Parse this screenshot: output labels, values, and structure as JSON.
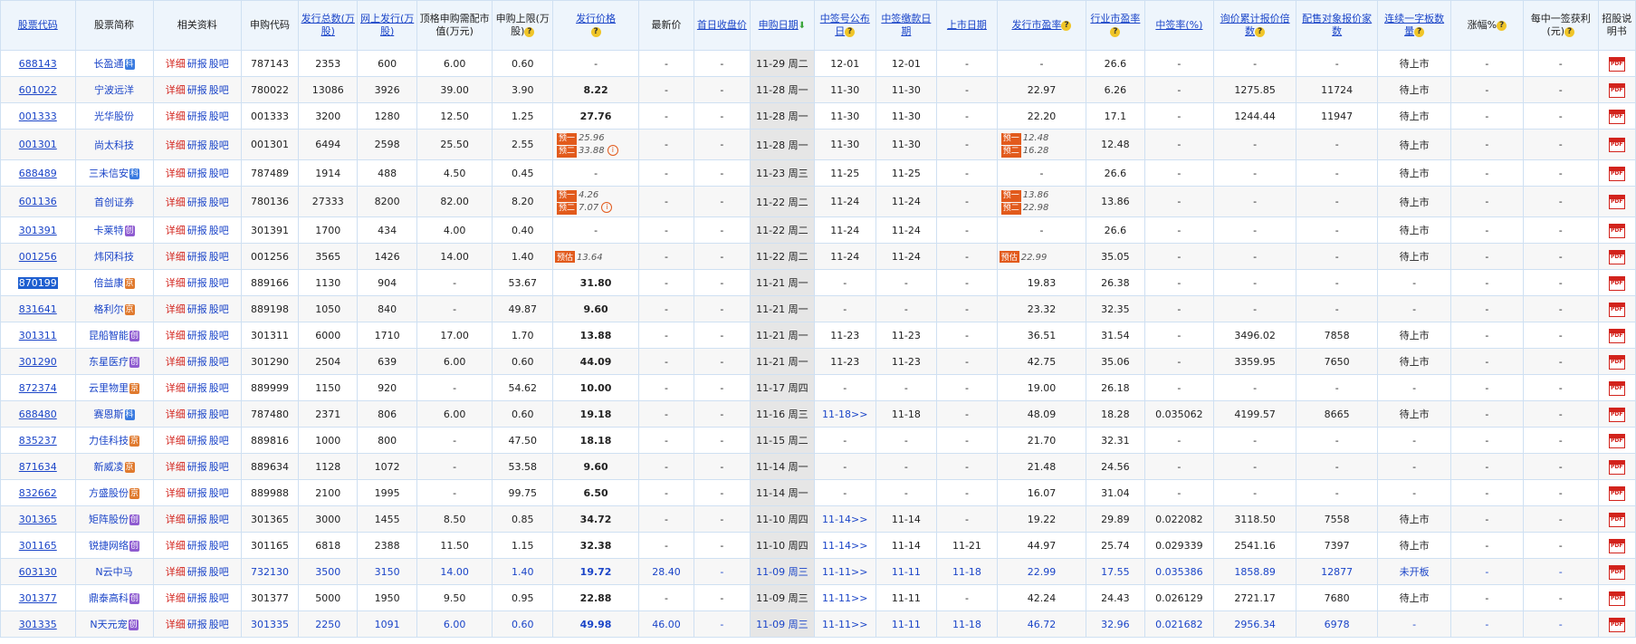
{
  "headers": {
    "code": "股票代码",
    "name": "股票简称",
    "related": "相关资料",
    "sub_code": "申购代码",
    "issue_total": "发行总数(万股)",
    "online_issue": "网上发行(万股)",
    "top_market_value": "顶格申购需配市值(万元)",
    "sub_limit": "申购上限(万股)",
    "issue_price": "发行价格",
    "latest_price": "最新价",
    "first_close": "首日收盘价",
    "sub_date": "申购日期",
    "announce_date": "中签号公布日",
    "pay_date": "中签缴款日期",
    "list_date": "上市日期",
    "issue_pe": "发行市盈率",
    "industry_pe": "行业市盈率",
    "win_rate": "中签率(%)",
    "inquiry_multiple": "询价累计报价倍数",
    "placement_count": "配售对象报价家数",
    "consecutive": "连续一字板数量",
    "change_pct": "涨幅%",
    "profit_per_lot": "每中一签获利(元)",
    "prospectus": "招股说明书"
  },
  "link_labels": {
    "detail": "详细",
    "research": "研报",
    "forum": "股吧"
  },
  "tags": {
    "ke": "科",
    "chuang": "创",
    "jing": "京"
  },
  "pred_labels": {
    "p1": "预一",
    "p2": "预二",
    "est": "预估"
  },
  "rows": [
    {
      "code": "688143",
      "name": "长盈通",
      "tag": "ke",
      "sub_code": "787143",
      "total": "2353",
      "online": "600",
      "topmv": "6.00",
      "limit": "0.60",
      "price": "-",
      "latest": "-",
      "first": "-",
      "date": "11-29 周二",
      "announce": "12-01",
      "pay": "12-01",
      "list": "-",
      "pe": "-",
      "ipe": "26.6",
      "rate": "-",
      "mult": "-",
      "place": "-",
      "cons": "待上市",
      "chg": "-",
      "profit": "-"
    },
    {
      "code": "601022",
      "name": "宁波远洋",
      "tag": "",
      "sub_code": "780022",
      "total": "13086",
      "online": "3926",
      "topmv": "39.00",
      "limit": "3.90",
      "price": "8.22",
      "latest": "-",
      "first": "-",
      "date": "11-28 周一",
      "announce": "11-30",
      "pay": "11-30",
      "list": "-",
      "pe": "22.97",
      "ipe": "6.26",
      "rate": "-",
      "mult": "1275.85",
      "place": "11724",
      "cons": "待上市",
      "chg": "-",
      "profit": "-"
    },
    {
      "code": "001333",
      "name": "光华股份",
      "tag": "",
      "sub_code": "001333",
      "total": "3200",
      "online": "1280",
      "topmv": "12.50",
      "limit": "1.25",
      "price": "27.76",
      "latest": "-",
      "first": "-",
      "date": "11-28 周一",
      "announce": "11-30",
      "pay": "11-30",
      "list": "-",
      "pe": "22.20",
      "ipe": "17.1",
      "rate": "-",
      "mult": "1244.44",
      "place": "11947",
      "cons": "待上市",
      "chg": "-",
      "profit": "-"
    },
    {
      "code": "001301",
      "name": "尚太科技",
      "tag": "",
      "sub_code": "001301",
      "total": "6494",
      "online": "2598",
      "topmv": "25.50",
      "limit": "2.55",
      "price_pred": [
        "25.96",
        "33.88"
      ],
      "latest": "-",
      "first": "-",
      "date": "11-28 周一",
      "announce": "11-30",
      "pay": "11-30",
      "list": "-",
      "pe_pred": [
        "12.48",
        "16.28"
      ],
      "ipe": "12.48",
      "rate": "-",
      "mult": "-",
      "place": "-",
      "cons": "待上市",
      "chg": "-",
      "profit": "-"
    },
    {
      "code": "688489",
      "name": "三未信安",
      "tag": "ke",
      "sub_code": "787489",
      "total": "1914",
      "online": "488",
      "topmv": "4.50",
      "limit": "0.45",
      "price": "-",
      "latest": "-",
      "first": "-",
      "date": "11-23 周三",
      "announce": "11-25",
      "pay": "11-25",
      "list": "-",
      "pe": "-",
      "ipe": "26.6",
      "rate": "-",
      "mult": "-",
      "place": "-",
      "cons": "待上市",
      "chg": "-",
      "profit": "-"
    },
    {
      "code": "601136",
      "name": "首创证券",
      "tag": "",
      "sub_code": "780136",
      "total": "27333",
      "online": "8200",
      "topmv": "82.00",
      "limit": "8.20",
      "price_pred": [
        "4.26",
        "7.07"
      ],
      "latest": "-",
      "first": "-",
      "date": "11-22 周二",
      "announce": "11-24",
      "pay": "11-24",
      "list": "-",
      "pe_pred": [
        "13.86",
        "22.98"
      ],
      "ipe": "13.86",
      "rate": "-",
      "mult": "-",
      "place": "-",
      "cons": "待上市",
      "chg": "-",
      "profit": "-"
    },
    {
      "code": "301391",
      "name": "卡莱特",
      "tag": "chuang",
      "sub_code": "301391",
      "total": "1700",
      "online": "434",
      "topmv": "4.00",
      "limit": "0.40",
      "price": "-",
      "latest": "-",
      "first": "-",
      "date": "11-22 周二",
      "announce": "11-24",
      "pay": "11-24",
      "list": "-",
      "pe": "-",
      "ipe": "26.6",
      "rate": "-",
      "mult": "-",
      "place": "-",
      "cons": "待上市",
      "chg": "-",
      "profit": "-"
    },
    {
      "code": "001256",
      "name": "炜冈科技",
      "tag": "",
      "sub_code": "001256",
      "total": "3565",
      "online": "1426",
      "topmv": "14.00",
      "limit": "1.40",
      "price_est": "13.64",
      "latest": "-",
      "first": "-",
      "date": "11-22 周二",
      "announce": "11-24",
      "pay": "11-24",
      "list": "-",
      "pe_est": "22.99",
      "ipe": "35.05",
      "rate": "-",
      "mult": "-",
      "place": "-",
      "cons": "待上市",
      "chg": "-",
      "profit": "-"
    },
    {
      "code": "870199",
      "name": "倍益康",
      "tag": "jing",
      "sub_code": "889166",
      "total": "1130",
      "online": "904",
      "topmv": "-",
      "limit": "53.67",
      "price": "31.80",
      "latest": "-",
      "first": "-",
      "date": "11-21 周一",
      "announce": "-",
      "pay": "-",
      "list": "-",
      "pe": "19.83",
      "ipe": "26.38",
      "rate": "-",
      "mult": "-",
      "place": "-",
      "cons": "-",
      "chg": "-",
      "profit": "-",
      "selected": true
    },
    {
      "code": "831641",
      "name": "格利尔",
      "tag": "jing",
      "sub_code": "889198",
      "total": "1050",
      "online": "840",
      "topmv": "-",
      "limit": "49.87",
      "price": "9.60",
      "latest": "-",
      "first": "-",
      "date": "11-21 周一",
      "announce": "-",
      "pay": "-",
      "list": "-",
      "pe": "23.32",
      "ipe": "32.35",
      "rate": "-",
      "mult": "-",
      "place": "-",
      "cons": "-",
      "chg": "-",
      "profit": "-"
    },
    {
      "code": "301311",
      "name": "昆船智能",
      "tag": "chuang",
      "sub_code": "301311",
      "total": "6000",
      "online": "1710",
      "topmv": "17.00",
      "limit": "1.70",
      "price": "13.88",
      "latest": "-",
      "first": "-",
      "date": "11-21 周一",
      "announce": "11-23",
      "pay": "11-23",
      "list": "-",
      "pe": "36.51",
      "ipe": "31.54",
      "rate": "-",
      "mult": "3496.02",
      "place": "7858",
      "cons": "待上市",
      "chg": "-",
      "profit": "-"
    },
    {
      "code": "301290",
      "name": "东星医疗",
      "tag": "chuang",
      "sub_code": "301290",
      "total": "2504",
      "online": "639",
      "topmv": "6.00",
      "limit": "0.60",
      "price": "44.09",
      "latest": "-",
      "first": "-",
      "date": "11-21 周一",
      "announce": "11-23",
      "pay": "11-23",
      "list": "-",
      "pe": "42.75",
      "ipe": "35.06",
      "rate": "-",
      "mult": "3359.95",
      "place": "7650",
      "cons": "待上市",
      "chg": "-",
      "profit": "-"
    },
    {
      "code": "872374",
      "name": "云里物里",
      "tag": "jing",
      "sub_code": "889999",
      "total": "1150",
      "online": "920",
      "topmv": "-",
      "limit": "54.62",
      "price": "10.00",
      "latest": "-",
      "first": "-",
      "date": "11-17 周四",
      "announce": "-",
      "pay": "-",
      "list": "-",
      "pe": "19.00",
      "ipe": "26.18",
      "rate": "-",
      "mult": "-",
      "place": "-",
      "cons": "-",
      "chg": "-",
      "profit": "-"
    },
    {
      "code": "688480",
      "name": "赛恩斯",
      "tag": "ke",
      "sub_code": "787480",
      "total": "2371",
      "online": "806",
      "topmv": "6.00",
      "limit": "0.60",
      "price": "19.18",
      "latest": "-",
      "first": "-",
      "date": "11-16 周三",
      "announce": "11-18>>",
      "pay": "11-18",
      "list": "-",
      "pe": "48.09",
      "ipe": "18.28",
      "rate": "0.035062",
      "mult": "4199.57",
      "place": "8665",
      "cons": "待上市",
      "chg": "-",
      "profit": "-"
    },
    {
      "code": "835237",
      "name": "力佳科技",
      "tag": "jing",
      "sub_code": "889816",
      "total": "1000",
      "online": "800",
      "topmv": "-",
      "limit": "47.50",
      "price": "18.18",
      "latest": "-",
      "first": "-",
      "date": "11-15 周二",
      "announce": "-",
      "pay": "-",
      "list": "-",
      "pe": "21.70",
      "ipe": "32.31",
      "rate": "-",
      "mult": "-",
      "place": "-",
      "cons": "-",
      "chg": "-",
      "profit": "-"
    },
    {
      "code": "871634",
      "name": "新威凌",
      "tag": "jing",
      "sub_code": "889634",
      "total": "1128",
      "online": "1072",
      "topmv": "-",
      "limit": "53.58",
      "price": "9.60",
      "latest": "-",
      "first": "-",
      "date": "11-14 周一",
      "announce": "-",
      "pay": "-",
      "list": "-",
      "pe": "21.48",
      "ipe": "24.56",
      "rate": "-",
      "mult": "-",
      "place": "-",
      "cons": "-",
      "chg": "-",
      "profit": "-"
    },
    {
      "code": "832662",
      "name": "方盛股份",
      "tag": "jing",
      "sub_code": "889988",
      "total": "2100",
      "online": "1995",
      "topmv": "-",
      "limit": "99.75",
      "price": "6.50",
      "latest": "-",
      "first": "-",
      "date": "11-14 周一",
      "announce": "-",
      "pay": "-",
      "list": "-",
      "pe": "16.07",
      "ipe": "31.04",
      "rate": "-",
      "mult": "-",
      "place": "-",
      "cons": "-",
      "chg": "-",
      "profit": "-"
    },
    {
      "code": "301365",
      "name": "矩阵股份",
      "tag": "chuang",
      "sub_code": "301365",
      "total": "3000",
      "online": "1455",
      "topmv": "8.50",
      "limit": "0.85",
      "price": "34.72",
      "latest": "-",
      "first": "-",
      "date": "11-10 周四",
      "announce": "11-14>>",
      "pay": "11-14",
      "list": "-",
      "pe": "19.22",
      "ipe": "29.89",
      "rate": "0.022082",
      "mult": "3118.50",
      "place": "7558",
      "cons": "待上市",
      "chg": "-",
      "profit": "-"
    },
    {
      "code": "301165",
      "name": "锐捷网络",
      "tag": "chuang",
      "sub_code": "301165",
      "total": "6818",
      "online": "2388",
      "topmv": "11.50",
      "limit": "1.15",
      "price": "32.38",
      "latest": "-",
      "first": "-",
      "date": "11-10 周四",
      "announce": "11-14>>",
      "pay": "11-14",
      "list": "11-21",
      "pe": "44.97",
      "ipe": "25.74",
      "rate": "0.029339",
      "mult": "2541.16",
      "place": "7397",
      "cons": "待上市",
      "chg": "-",
      "profit": "-"
    },
    {
      "code": "603130",
      "name": "N云中马",
      "tag": "",
      "sub_code": "732130",
      "total": "3500",
      "online": "3150",
      "topmv": "14.00",
      "limit": "1.40",
      "price": "19.72",
      "latest": "28.40",
      "first": "-",
      "date": "11-09 周三",
      "announce": "11-11>>",
      "pay": "11-11",
      "list": "11-18",
      "pe": "22.99",
      "ipe": "17.55",
      "rate": "0.035386",
      "mult": "1858.89",
      "place": "12877",
      "cons": "未开板",
      "chg": "-",
      "profit": "-",
      "trading": true
    },
    {
      "code": "301377",
      "name": "鼎泰高科",
      "tag": "chuang",
      "sub_code": "301377",
      "total": "5000",
      "online": "1950",
      "topmv": "9.50",
      "limit": "0.95",
      "price": "22.88",
      "latest": "-",
      "first": "-",
      "date": "11-09 周三",
      "announce": "11-11>>",
      "pay": "11-11",
      "list": "-",
      "pe": "42.24",
      "ipe": "24.43",
      "rate": "0.026129",
      "mult": "2721.17",
      "place": "7680",
      "cons": "待上市",
      "chg": "-",
      "profit": "-"
    },
    {
      "code": "301335",
      "name": "N天元宠",
      "tag": "chuang",
      "sub_code": "301335",
      "total": "2250",
      "online": "1091",
      "topmv": "6.00",
      "limit": "0.60",
      "price": "49.98",
      "latest": "46.00",
      "first": "-",
      "date": "11-09 周三",
      "announce": "11-11>>",
      "pay": "11-11",
      "list": "11-18",
      "pe": "46.72",
      "ipe": "32.96",
      "rate": "0.021682",
      "mult": "2956.34",
      "place": "6978",
      "cons": "-",
      "chg": "-",
      "profit": "-",
      "trading": true
    }
  ],
  "pdf_label": "PDF",
  "icons": {
    "help": "question-icon",
    "sort": "sort-down-icon",
    "pdf": "pdf-icon",
    "info": "info-icon"
  }
}
